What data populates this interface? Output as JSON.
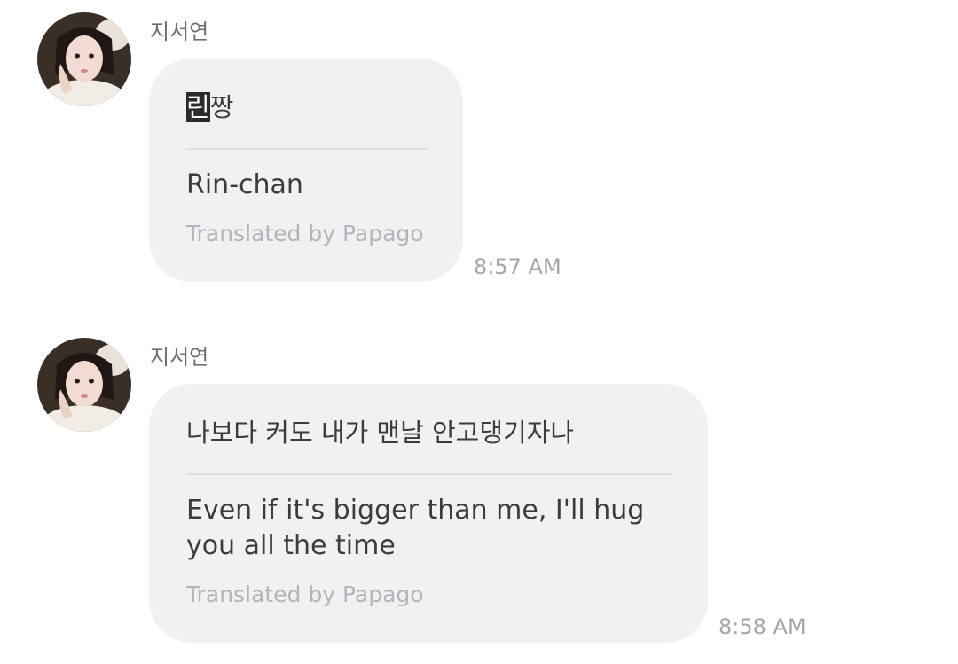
{
  "messages": [
    {
      "sender": "지서연",
      "original_highlight": "린",
      "original_rest": "짱",
      "translation": "Rin-chan",
      "credit": "Translated by Papago",
      "time": "8:57 AM"
    },
    {
      "sender": "지서연",
      "original_text": "나보다 커도 내가 맨날 안고댕기자나",
      "translation": "Even if it's bigger than me, I'll hug you all the time",
      "credit": "Translated by Papago",
      "time": "8:58 AM"
    }
  ],
  "icons": {
    "avatar": "profile-photo"
  }
}
